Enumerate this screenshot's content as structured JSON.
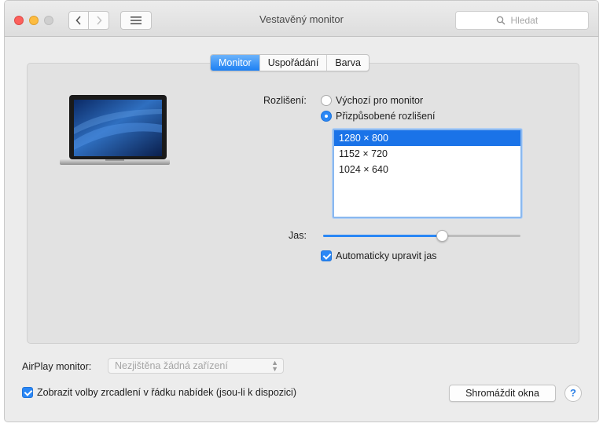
{
  "window": {
    "title": "Vestavěný monitor"
  },
  "search": {
    "placeholder": "Hledat"
  },
  "tabs": [
    {
      "label": "Monitor",
      "active": true
    },
    {
      "label": "Uspořádání",
      "active": false
    },
    {
      "label": "Barva",
      "active": false
    }
  ],
  "resolution": {
    "label": "Rozlišení:",
    "options": [
      {
        "label": "Výchozí pro monitor",
        "selected": false
      },
      {
        "label": "Přizpůsobené rozlišení",
        "selected": true
      }
    ],
    "list": [
      "1280 × 800",
      "1152 × 720",
      "1024 × 640"
    ],
    "selected_index": 0
  },
  "brightness": {
    "label": "Jas:",
    "level": 0.6,
    "auto_label": "Automaticky upravit jas",
    "auto_checked": true
  },
  "airplay": {
    "label": "AirPlay monitor:",
    "value": "Nezjištěna žádná zařízení"
  },
  "mirroring": {
    "label": "Zobrazit volby zrcadlení v řádku nabídek (jsou-li k dispozici)",
    "checked": true
  },
  "gather_button": "Shromáždit okna",
  "help_label": "?",
  "colors": {
    "accent": "#2a87f5",
    "selection": "#1a73e8"
  }
}
